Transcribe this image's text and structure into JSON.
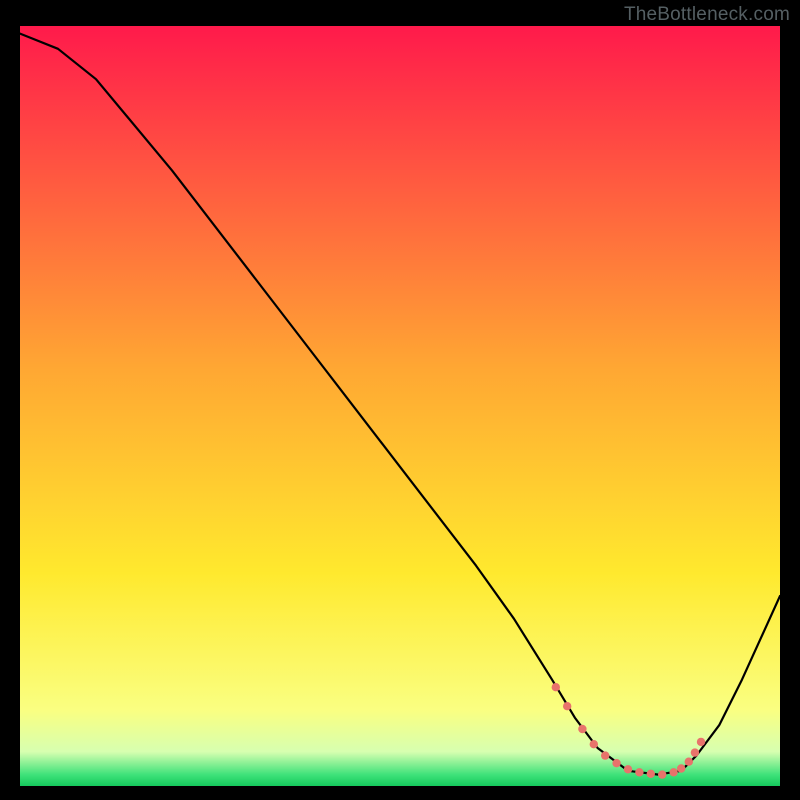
{
  "attribution": "TheBottleneck.com",
  "chart_data": {
    "type": "line",
    "title": "",
    "xlabel": "",
    "ylabel": "",
    "xlim": [
      0,
      100
    ],
    "ylim": [
      0,
      100
    ],
    "grid": false,
    "legend": false,
    "gradient_stops": [
      {
        "offset": 0.0,
        "color": "#ff1a4b"
      },
      {
        "offset": 0.45,
        "color": "#ffa733"
      },
      {
        "offset": 0.72,
        "color": "#ffe92e"
      },
      {
        "offset": 0.9,
        "color": "#faff81"
      },
      {
        "offset": 0.955,
        "color": "#d7ffb0"
      },
      {
        "offset": 0.985,
        "color": "#3fe27a"
      },
      {
        "offset": 1.0,
        "color": "#15c95c"
      }
    ],
    "series": [
      {
        "name": "bottleneck-curve",
        "x": [
          0.0,
          5.0,
          10.0,
          20.0,
          30.0,
          40.0,
          50.0,
          60.0,
          65.0,
          70.0,
          73.0,
          76.0,
          80.0,
          84.0,
          87.0,
          89.0,
          92.0,
          95.0,
          100.0
        ],
        "y": [
          99.0,
          97.0,
          93.0,
          81.0,
          68.0,
          55.0,
          42.0,
          29.0,
          22.0,
          14.0,
          9.0,
          5.0,
          2.0,
          1.5,
          2.0,
          4.0,
          8.0,
          14.0,
          25.0
        ]
      }
    ],
    "highlight_points": {
      "name": "optimal-zone-dots",
      "color": "#e8736b",
      "radius": 4.2,
      "x": [
        70.5,
        72.0,
        74.0,
        75.5,
        77.0,
        78.5,
        80.0,
        81.5,
        83.0,
        84.5,
        86.0,
        87.0,
        88.0,
        88.8,
        89.6
      ],
      "y": [
        13.0,
        10.5,
        7.5,
        5.5,
        4.0,
        3.0,
        2.2,
        1.8,
        1.6,
        1.5,
        1.8,
        2.3,
        3.2,
        4.4,
        5.8
      ]
    }
  }
}
